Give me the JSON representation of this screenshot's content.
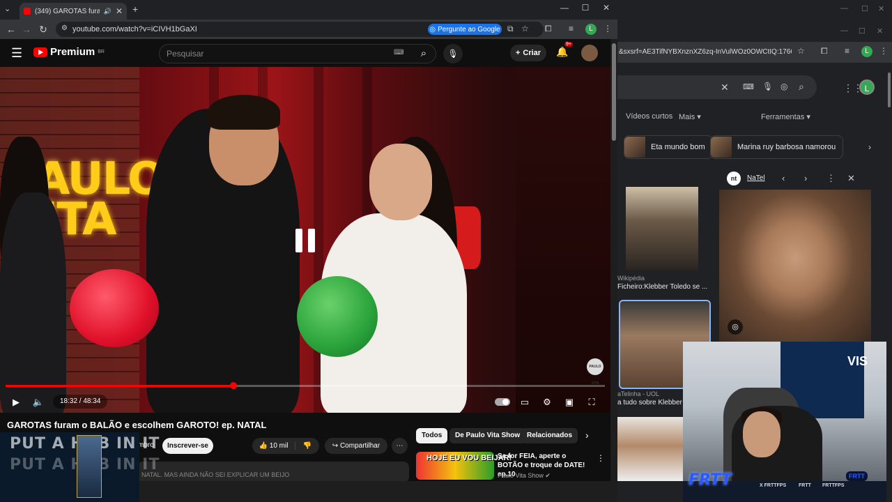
{
  "left_browser": {
    "tab_title": "(349) GAROTAS furam o BALÃ",
    "url": "youtube.com/watch?v=iCIVH1bGaXI",
    "gemini_label": "Pergunte ao Google",
    "profile_initial": "L"
  },
  "youtube": {
    "brand": "Premium",
    "brand_region": "BR",
    "search_placeholder": "Pesquisar",
    "create_label": "Criar",
    "notification_count": "9+",
    "video": {
      "overlay_brand_line1": "PAULO",
      "overlay_brand_line2": "VITA",
      "watermark": "PAULO VITA",
      "time": "18:32 / 48:34",
      "progress": 0.38
    },
    "title": "GAROTAS furam o BALÃO e escolhem GAROTO! ep. NATAL",
    "member_partial": "mbro",
    "subscribe_label": "Inscrever-se",
    "likes": "10 mil",
    "share_label": "Compartilhar",
    "description_partial": "NATAL. MAS AINDA NÃO SEI EXPLICAR UM BEIJO",
    "chips": [
      "Todos",
      "De Paulo Vita Show",
      "Relacionados"
    ],
    "recommended": {
      "thumb_text": "HOJE EU VOU BEIJAR!",
      "title": "Se for FEIA, aperte o BOTÃO e troque de DATE! ep.10",
      "channel": "Paulo Vita Show"
    }
  },
  "overlay_left": {
    "text": "PUT A HOB     IN IT"
  },
  "right_browser": {
    "url_partial": "&sxsrf=AE3TifNYBXnznXZ6zq-InVulWOz0OWCtIQ:1766374...",
    "profile_initial": "L",
    "filters": [
      "Vídeos curtos",
      "Mais",
      "Ferramentas"
    ],
    "chips": [
      "Eta mundo bom",
      "Marina ruy barbosa namorou"
    ],
    "results": [
      {
        "source": "Wikipédia",
        "caption": "Ficheiro:Klebber Toledo se ..."
      },
      {
        "source": "aTelinha - UOL",
        "caption": "a tudo sobre Klebber"
      }
    ],
    "panel": {
      "logo": "nt",
      "name": "NaTel"
    }
  },
  "stream_overlay": {
    "banner_text": "VIS",
    "logo": "FRTT",
    "logo_right": "FRTT",
    "tags": [
      "X FRTTFPS",
      "FRTT",
      "FRTTFPS"
    ]
  }
}
